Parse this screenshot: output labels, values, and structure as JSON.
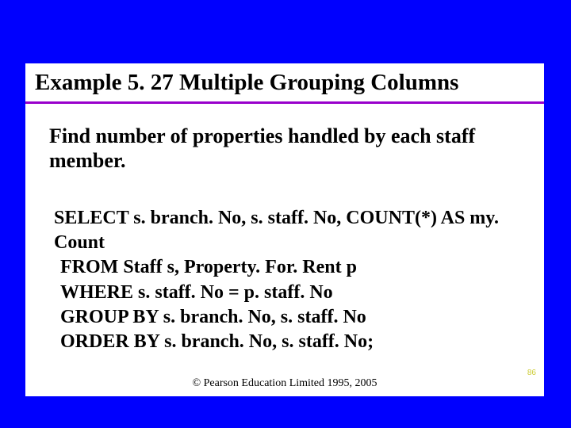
{
  "slide": {
    "title": "Example 5. 27  Multiple Grouping Columns",
    "description": "Find number of properties handled by each staff member.",
    "sql": {
      "line1": "SELECT s. branch. No, s. staff. No, COUNT(*) AS my. Count",
      "line2": "FROM Staff s, Property. For. Rent p",
      "line3": "WHERE s. staff. No = p. staff. No",
      "line4": "GROUP BY s. branch. No, s. staff. No",
      "line5": "ORDER BY s. branch. No, s. staff. No;"
    },
    "footer": "© Pearson Education Limited 1995, 2005",
    "page_number": "86"
  }
}
